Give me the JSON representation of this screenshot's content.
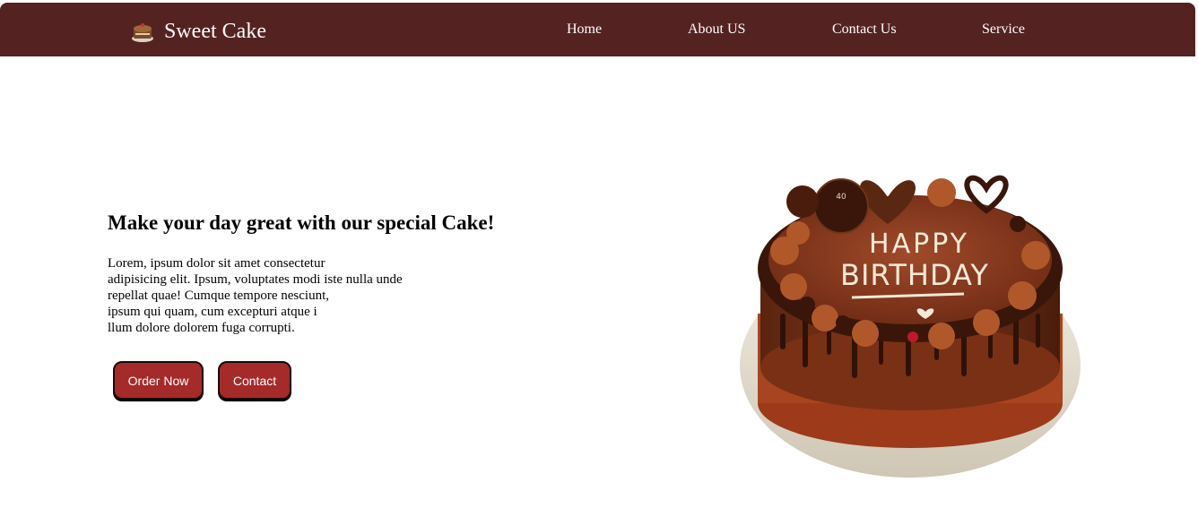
{
  "brand": {
    "name": "Sweet Cake",
    "icon": "cake-icon"
  },
  "nav": {
    "items": [
      {
        "label": "Home"
      },
      {
        "label": "About US"
      },
      {
        "label": "Contact Us"
      },
      {
        "label": "Service"
      }
    ]
  },
  "hero": {
    "title": "Make your day great with our special Cake!",
    "body_lines": [
      "Lorem, ipsum dolor sit amet consectetur",
      "adipisicing elit. Ipsum, voluptates modi iste nulla unde",
      "repellat quae! Cumque tempore nesciunt,",
      "ipsum qui quam, cum excepturi atque i",
      "llum dolore dolorem fuga corrupti."
    ],
    "order_label": "Order Now",
    "contact_label": "Contact"
  },
  "image": {
    "icon": "birthday-cake-image",
    "top_text": "HAPPY",
    "bottom_text": "BIRTHDAY",
    "badge_text": "40"
  },
  "colors": {
    "navbar": "#552222",
    "button": "#a52a2a",
    "text": "#000000"
  }
}
